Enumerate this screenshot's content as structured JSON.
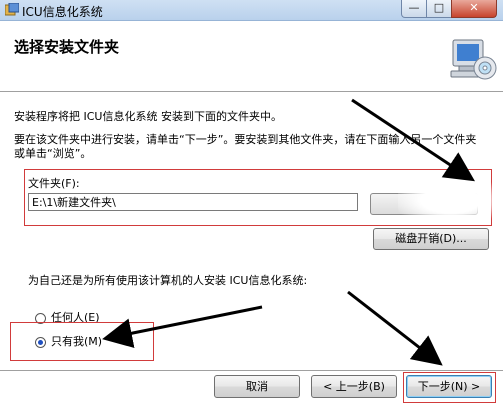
{
  "window": {
    "title": "ICU信息化系统",
    "minimize_glyph": "—",
    "maximize_glyph": "□",
    "close_glyph": "✕"
  },
  "header": {
    "heading": "选择安装文件夹",
    "icon": "computer-cd-icon"
  },
  "body": {
    "intro": "安装程序将把 ICU信息化系统 安装到下面的文件夹中。",
    "instructions": "要在该文件夹中进行安装，请单击“下一步”。要安装到其他文件夹，请在下面输入另一个文件夹或单击“浏览”。",
    "folder_label": "文件夹(F):",
    "folder_value": "E:\\1\\新建文件夹\\",
    "disk_cost_label": "磁盘开销(D)...",
    "install_for_text": "为自己还是为所有使用该计算机的人安装 ICU信息化系统:",
    "radio_everyone_label": "任何人(E)",
    "radio_justme_label": "只有我(M)",
    "selected_option": "只有我(M)"
  },
  "footer": {
    "cancel_label": "取消",
    "back_label": "< 上一步(B)",
    "next_label": "下一步(N) >"
  },
  "colors": {
    "annotation_red": "#d13b3b",
    "arrow": "#000000",
    "titlebar": "#c4d8ef"
  }
}
